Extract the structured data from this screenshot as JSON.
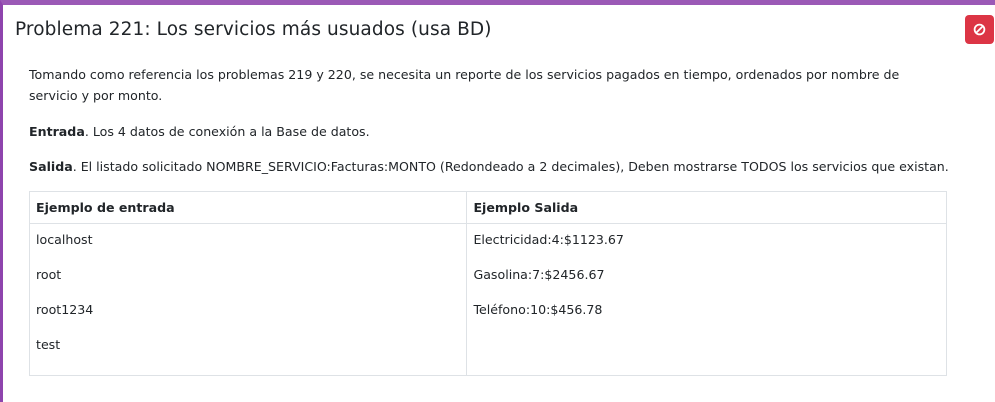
{
  "problem": {
    "title": "Problema 221: Los servicios más usuados (usa BD)",
    "description": "Tomando como referencia los problemas 219 y 220, se necesita un reporte de los servicios pagados en tiempo, ordenados por nombre de servicio y por monto.",
    "input_label": "Entrada",
    "input_text": ". Los 4 datos de conexión a la Base de datos.",
    "output_label": "Salida",
    "output_text": ". El listado solicitado NOMBRE_SERVICIO:Facturas:MONTO (Redondeado a 2 decimales), Deben mostrarse TODOS los servicios que existan."
  },
  "examples": {
    "input_header": "Ejemplo de entrada",
    "output_header": "Ejemplo Salida",
    "input_lines": [
      "localhost",
      "root",
      "root1234",
      "test"
    ],
    "output_lines": [
      "Electricidad:4:$1123.67",
      "Gasolina:7:$2456.67",
      "Teléfono:10:$456.78"
    ]
  },
  "icons": {
    "close": "ban-icon"
  },
  "colors": {
    "accent_border": "#9b59b6",
    "danger": "#dc3545"
  }
}
